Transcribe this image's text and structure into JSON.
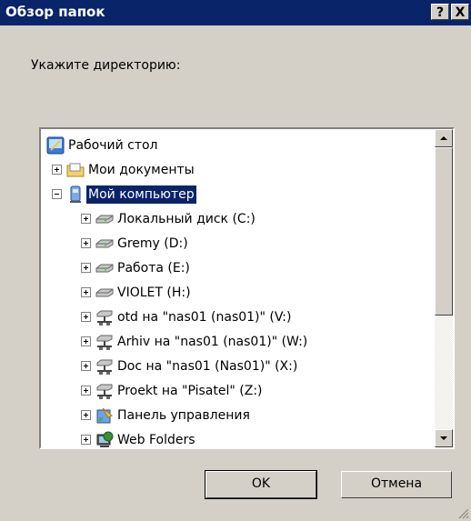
{
  "window": {
    "title": "Обзор папок",
    "help_label": "?",
    "close_label": "X"
  },
  "prompt": "Укажите директорию:",
  "tree": {
    "items": [
      {
        "label": "Рабочий стол",
        "icon": "desktop-icon"
      },
      {
        "label": "Мои документы",
        "icon": "folder-icon"
      },
      {
        "label": "Мой компьютер",
        "icon": "computer-icon"
      },
      {
        "label": "Локальный диск (C:)",
        "icon": "drive-icon"
      },
      {
        "label": "Gremy (D:)",
        "icon": "drive-icon"
      },
      {
        "label": "Работа (E:)",
        "icon": "drive-icon"
      },
      {
        "label": "VIOLET (H:)",
        "icon": "drive-icon"
      },
      {
        "label": "otd на \"nas01 (nas01)\" (V:)",
        "icon": "network-drive-icon"
      },
      {
        "label": "Arhiv на \"nas01 (nas01)\" (W:)",
        "icon": "network-drive-icon"
      },
      {
        "label": "Doc на \"nas01 (Nas01)\" (X:)",
        "icon": "network-drive-icon"
      },
      {
        "label": "Proekt на \"Pisatel\" (Z:)",
        "icon": "network-drive-icon"
      },
      {
        "label": "Панель управления",
        "icon": "control-panel-icon"
      },
      {
        "label": "Web Folders",
        "icon": "web-folders-icon"
      }
    ],
    "selected_label": "Мой компьютер"
  },
  "buttons": {
    "ok_label": "OK",
    "cancel_label": "Отмена"
  },
  "colors": {
    "titlebar": "#0a246a",
    "selection": "#0a246a",
    "face": "#d4d0c8"
  }
}
